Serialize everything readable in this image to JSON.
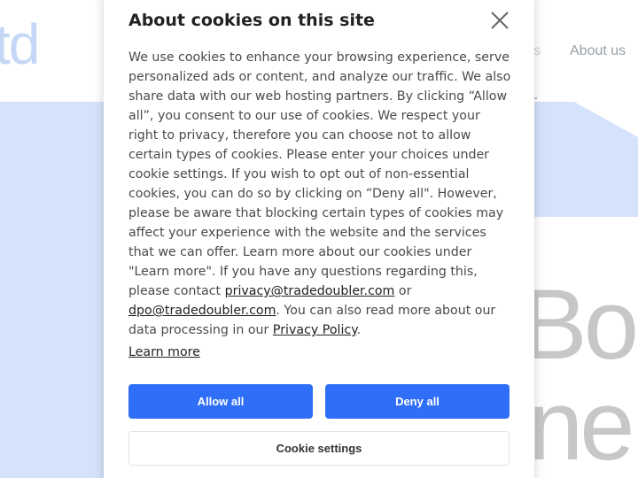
{
  "background": {
    "logo_fragment": "td",
    "nav_fragment": "s",
    "nav_about": "About us",
    "hero_line1": "Boo",
    "hero_line2": "ne"
  },
  "dialog": {
    "title": "About cookies on this site",
    "close_icon": "close-icon",
    "body_part1": "We use cookies to enhance your browsing experience, serve personalized ads or content, and analyze our traffic. We also share data with our web hosting partners. By clicking “Allow all”, you consent to our use of cookies. We respect your right to privacy, therefore you can choose not to allow certain types of cookies. Please enter your choices under cookie settings. If you wish to opt out of non-essential cookies, you can do so by clicking on “Deny all\". However, please be aware that blocking certain types of cookies may affect your experience with the website and the services that we can offer. Learn more about our cookies under \"Learn more\". If you have any questions regarding this, please contact ",
    "email_privacy": "privacy@tradedoubler.com",
    "body_or": " or ",
    "email_dpo": "dpo@tradedoubler.com",
    "body_part2": ". You can also read more about our data processing in our ",
    "privacy_policy_link": "Privacy Policy",
    "body_end": ".",
    "learn_more": "Learn more",
    "allow_all": "Allow all",
    "deny_all": "Deny all",
    "cookie_settings": "Cookie settings"
  },
  "colors": {
    "primary_button": "#2f6ef7",
    "hero_background": "#d4e3fb",
    "logo": "#c5d7f6"
  }
}
